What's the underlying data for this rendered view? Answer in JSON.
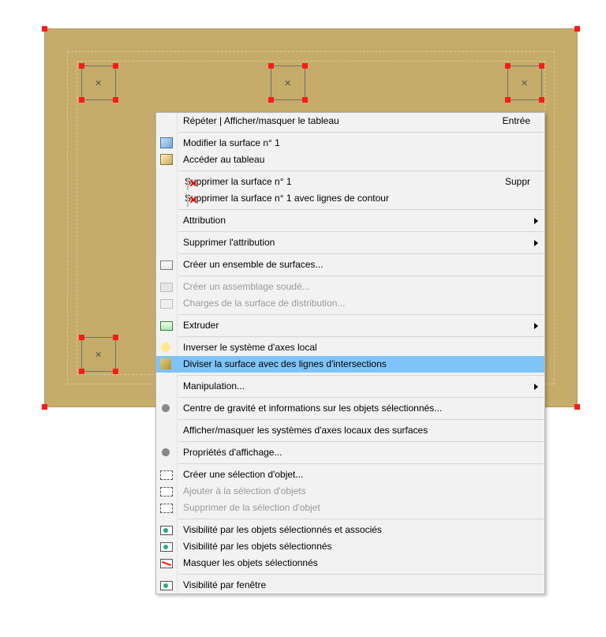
{
  "menu": {
    "repeat": {
      "label": "Répéter | Afficher/masquer le tableau",
      "shortcut": "Entrée"
    },
    "editSurface": "Modifier la surface n° 1",
    "goTable": "Accéder au tableau",
    "delSurface": {
      "label": "Supprimer la surface n° 1",
      "shortcut": "Suppr"
    },
    "delSurfaceContour": "Supprimer la surface n° 1 avec lignes de contour",
    "attribution": "Attribution",
    "delAttribution": "Supprimer l'attribution",
    "createSet": "Créer un ensemble de surfaces...",
    "createAsm": "Créer un assemblage soudé...",
    "charges": "Charges de la surface de distribution...",
    "extrude": "Extruder",
    "invertAxes": "Inverser le système d'axes local",
    "divide": "Diviser la surface avec des lignes d'intersections",
    "manipulation": "Manipulation...",
    "centroid": "Centre de gravité et informations sur les objets sélectionnés...",
    "toggleAxes": "Afficher/masquer les systèmes d'axes locaux des surfaces",
    "dispProps": "Propriétés d'affichage...",
    "createSel": "Créer une sélection d'objet...",
    "addSel": "Ajouter à la sélection d'objets",
    "removeSel": "Supprimer de la sélection d'objet",
    "visAssoc": "Visibilité par les objets sélectionnés et associés",
    "visSel": "Visibilité par les objets sélectionnés",
    "maskSel": "Masquer les objets sélectionnés",
    "visWindow": "Visibilité par fenêtre"
  }
}
